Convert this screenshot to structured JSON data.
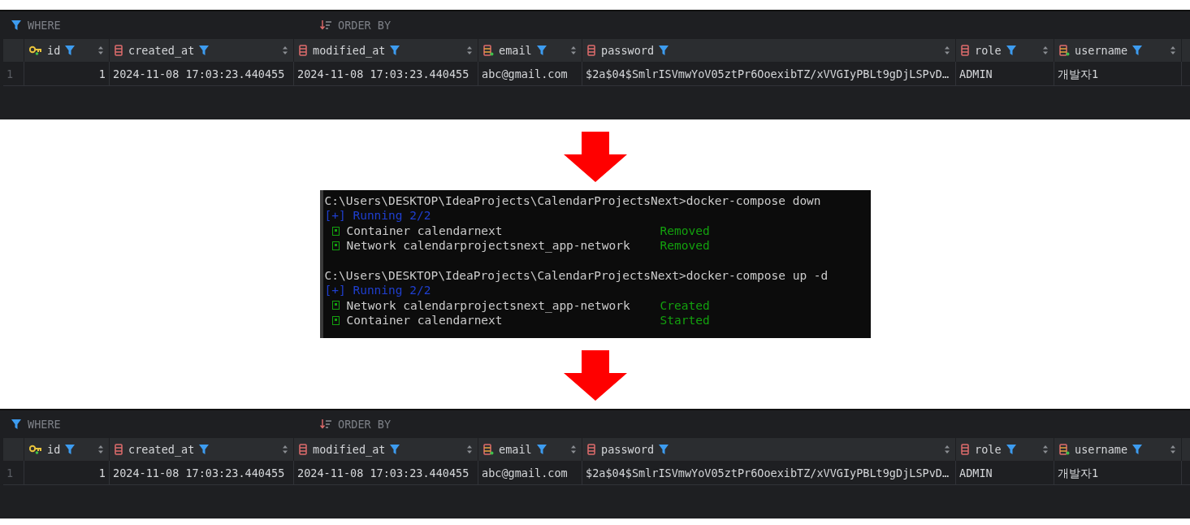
{
  "sections": [
    {
      "kind": "table",
      "where_label": "WHERE",
      "order_label": "ORDER BY",
      "columns": [
        {
          "name": "id",
          "kind": "key"
        },
        {
          "name": "created_at",
          "kind": "column"
        },
        {
          "name": "modified_at",
          "kind": "column"
        },
        {
          "name": "email",
          "kind": "indexed"
        },
        {
          "name": "password",
          "kind": "column"
        },
        {
          "name": "role",
          "kind": "column"
        },
        {
          "name": "username",
          "kind": "indexed"
        }
      ],
      "rows": [
        {
          "number": "1",
          "cells": [
            "1",
            "2024-11-08 17:03:23.440455",
            "2024-11-08 17:03:23.440455",
            "abc@gmail.com",
            "$2a$04$SmlrISVmwYoV05ztPr6OoexibTZ/xVVGIyPBLt9gDjLSPvD…",
            "ADMIN",
            "개발자1"
          ]
        }
      ]
    },
    {
      "kind": "terminal",
      "lines": [
        {
          "kind": "prompt",
          "text": "C:\\Users\\DESKTOP\\IdeaProjects\\CalendarProjectsNext>docker-compose down"
        },
        {
          "kind": "progress",
          "text": "[+] Running 2/2"
        },
        {
          "kind": "item",
          "text": "Container calendarnext",
          "status": "Removed"
        },
        {
          "kind": "item",
          "text": "Network calendarprojectsnext_app-network",
          "status": "Removed"
        },
        {
          "kind": "blank"
        },
        {
          "kind": "prompt",
          "text": "C:\\Users\\DESKTOP\\IdeaProjects\\CalendarProjectsNext>docker-compose up -d"
        },
        {
          "kind": "progress",
          "text": "[+] Running 2/2"
        },
        {
          "kind": "item",
          "text": "Network calendarprojectsnext_app-network",
          "status": "Created"
        },
        {
          "kind": "item",
          "text": "Container calendarnext",
          "status": "Started"
        }
      ]
    },
    {
      "kind": "table",
      "where_label": "WHERE",
      "order_label": "ORDER BY",
      "columns": [
        {
          "name": "id",
          "kind": "key"
        },
        {
          "name": "created_at",
          "kind": "column"
        },
        {
          "name": "modified_at",
          "kind": "column"
        },
        {
          "name": "email",
          "kind": "indexed"
        },
        {
          "name": "password",
          "kind": "column"
        },
        {
          "name": "role",
          "kind": "column"
        },
        {
          "name": "username",
          "kind": "indexed"
        }
      ],
      "rows": [
        {
          "number": "1",
          "cells": [
            "1",
            "2024-11-08 17:03:23.440455",
            "2024-11-08 17:03:23.440455",
            "abc@gmail.com",
            "$2a$04$SmlrISVmwYoV05ztPr6OoexibTZ/xVVGIyPBLt9gDjLSPvD…",
            "ADMIN",
            "개발자1"
          ]
        }
      ]
    }
  ]
}
